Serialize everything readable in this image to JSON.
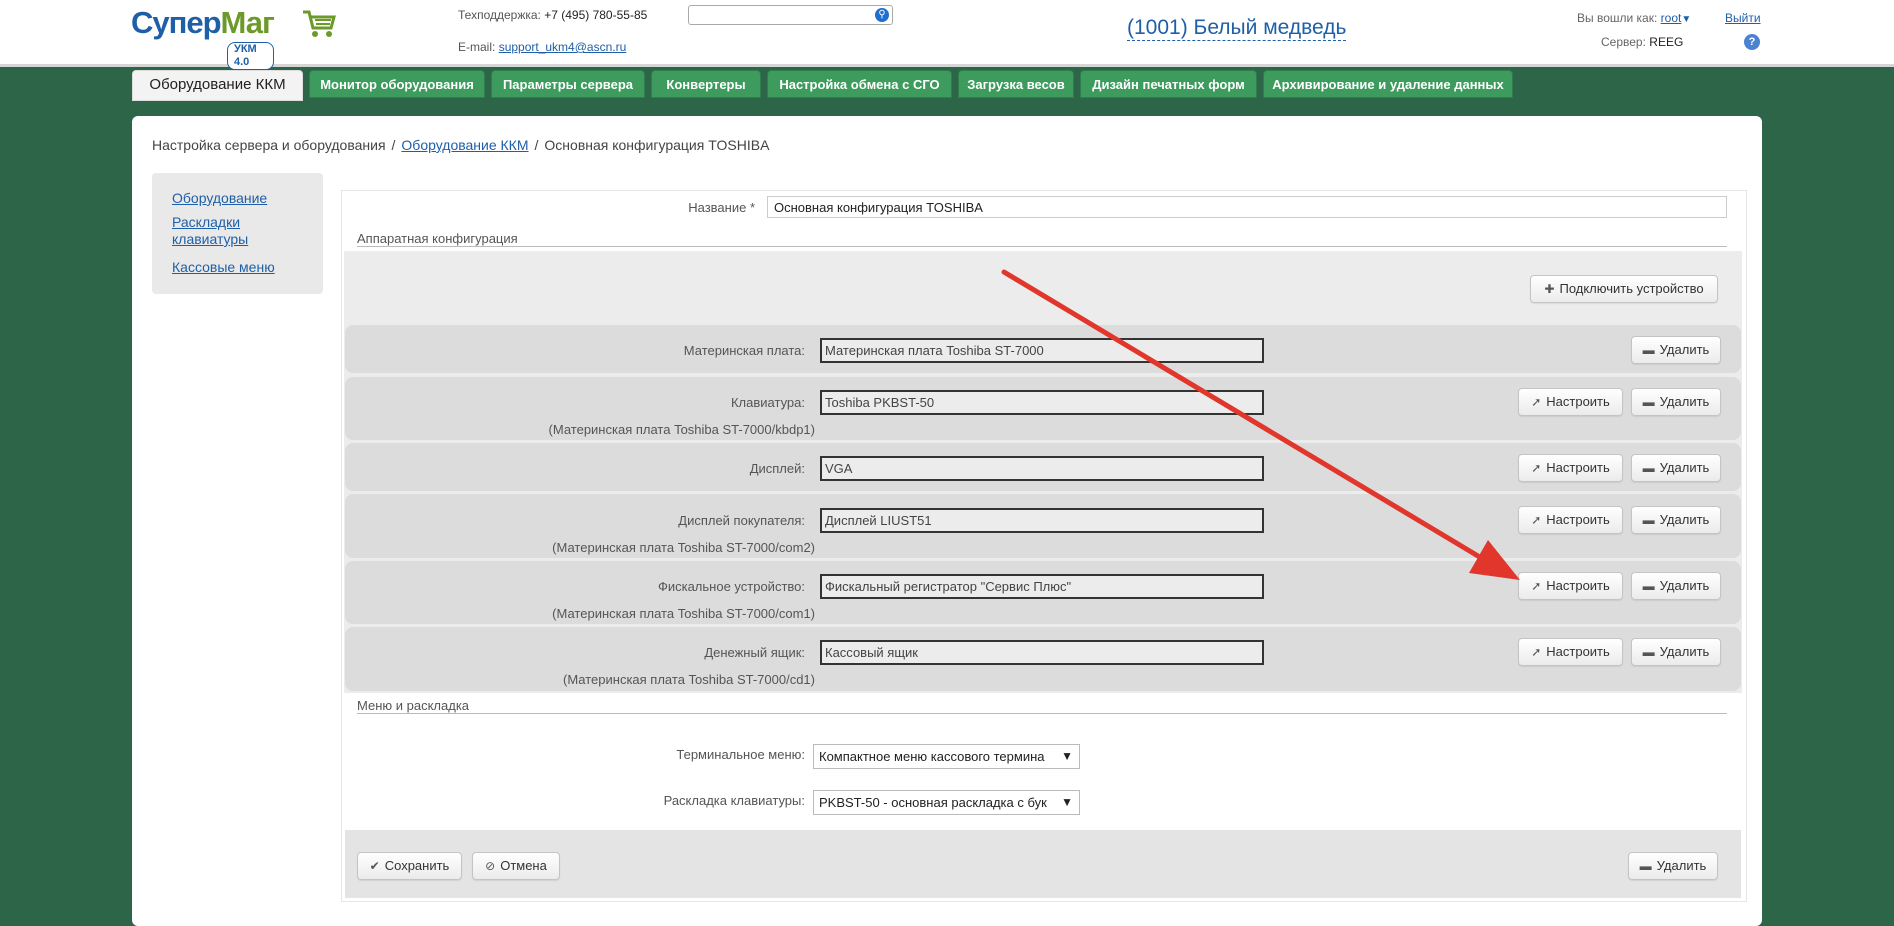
{
  "header": {
    "logo_part1": "Супер",
    "logo_part2": "Маг",
    "logo_version": "УКМ 4.0",
    "support_label": "Техподдержка:",
    "support_phone": "+7 (495) 780-55-85",
    "email_label": "E-mail:",
    "email": "support_ukm4@ascn.ru",
    "search_placeholder": "",
    "store": "(1001) Белый медведь",
    "logged_as_label": "Вы вошли как:",
    "user": "root",
    "logout": "Выйти",
    "server_label": "Сервер:",
    "server_value": "REEG",
    "help": "?"
  },
  "tabs": [
    {
      "label": "Оборудование ККМ",
      "active": true
    },
    {
      "label": "Монитор оборудования"
    },
    {
      "label": "Параметры сервера"
    },
    {
      "label": "Конвертеры"
    },
    {
      "label": "Настройка обмена с СГО"
    },
    {
      "label": "Загрузка весов"
    },
    {
      "label": "Дизайн печатных форм"
    },
    {
      "label": "Архивирование и удаление данных"
    }
  ],
  "breadcrumb": {
    "root": "Настройка сервера и оборудования",
    "link": "Оборудование ККМ",
    "current": "Основная конфигурация TOSHIBA",
    "separator": "/"
  },
  "sidenav": [
    {
      "label": "Оборудование"
    },
    {
      "label": "Раскладки клавиатуры"
    },
    {
      "label": "Кассовые меню"
    }
  ],
  "form": {
    "name_label": "Название *",
    "name_value": "Основная конфигурация TOSHIBA",
    "hw_section": "Аппаратная конфигурация",
    "connect_button": "Подключить устройство",
    "configure_label": "Настроить",
    "delete_label": "Удалить",
    "devices": [
      {
        "label": "Материнская плата:",
        "value": "Материнская плата Toshiba ST-7000",
        "sub": "",
        "configurable": false
      },
      {
        "label": "Клавиатура:",
        "value": "Toshiba PKBST-50",
        "sub": "(Материнская плата Toshiba ST-7000/kbdp1)",
        "configurable": true
      },
      {
        "label": "Дисплей:",
        "value": "VGA",
        "sub": "",
        "configurable": true
      },
      {
        "label": "Дисплей покупателя:",
        "value": "Дисплей LIUST51",
        "sub": "(Материнская плата Toshiba ST-7000/com2)",
        "configurable": true
      },
      {
        "label": "Фискальное устройство:",
        "value": "Фискальный регистратор \"Сервис Плюс\"",
        "sub": "(Материнская плата Toshiba ST-7000/com1)",
        "configurable": true
      },
      {
        "label": "Денежный ящик:",
        "value": "Кассовый ящик",
        "sub": "(Материнская плата Toshiba ST-7000/cd1)",
        "configurable": true
      }
    ],
    "menu_section": "Меню и раскладка",
    "terminal_menu_label": "Терминальное меню:",
    "terminal_menu_value": "Компактное меню кассового термина",
    "layout_label": "Раскладка клавиатуры:",
    "layout_value": "PKBST-50 - основная раскладка с бук",
    "save": "Сохранить",
    "cancel": "Отмена",
    "delete": "Удалить"
  },
  "colors": {
    "page_bg": "#2c6548",
    "tab_bg": "#3c9b5d",
    "link": "#1f5fa8",
    "arrow": "#e0362b"
  },
  "icons": {
    "cart": "shopping-cart-icon",
    "search": "magnifier-icon",
    "plus": "plus-icon",
    "minus": "minus-icon",
    "wrench": "pencil-icon",
    "check": "check-icon",
    "cancel": "cancel-circle-icon"
  }
}
